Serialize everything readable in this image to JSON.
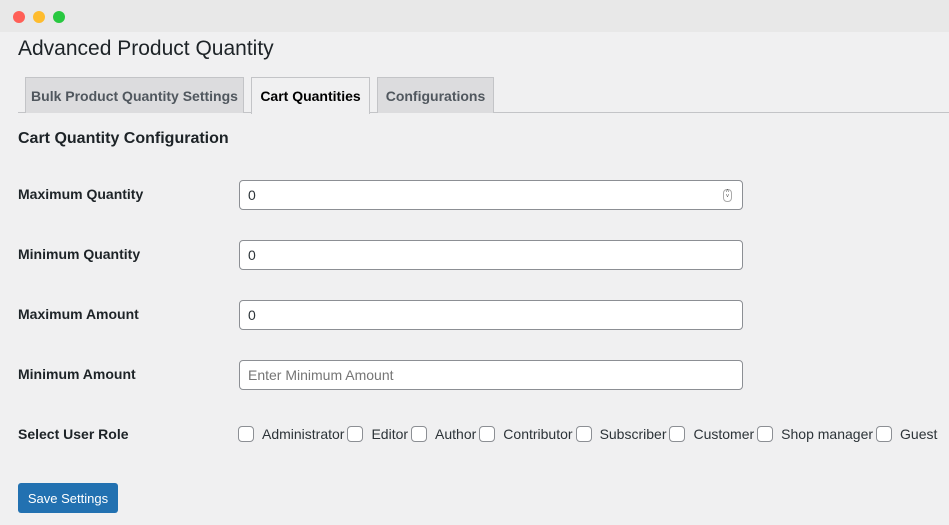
{
  "window": {
    "controls": {
      "close": "#ff5f57",
      "minimize": "#febc2e",
      "zoom": "#28c840"
    }
  },
  "title": "Advanced Product Quantity",
  "tabs": [
    {
      "label": "Bulk Product Quantity Settings",
      "active": false
    },
    {
      "label": "Cart Quantities",
      "active": true
    },
    {
      "label": "Configurations",
      "active": false
    }
  ],
  "section_title": "Cart Quantity Configuration",
  "fields": [
    {
      "label": "Maximum Quantity",
      "value": "0",
      "placeholder": ""
    },
    {
      "label": "Minimum Quantity",
      "value": "0",
      "placeholder": ""
    },
    {
      "label": "Maximum Amount",
      "value": "0",
      "placeholder": ""
    },
    {
      "label": "Minimum Amount",
      "value": "",
      "placeholder": "Enter Minimum Amount"
    }
  ],
  "user_role": {
    "label": "Select User Role",
    "options": [
      "Administrator",
      "Editor",
      "Author",
      "Contributor",
      "Subscriber",
      "Customer",
      "Shop manager",
      "Guest"
    ]
  },
  "save_label": "Save Settings",
  "accent": "#2271b1"
}
